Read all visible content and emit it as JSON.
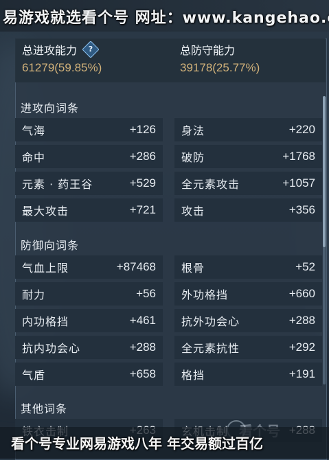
{
  "watermark_top": "易游戏就选看个号  网址：www.kangehao.c",
  "watermark_bottom": "看个号专业网易游戏八年  年交易额过百亿",
  "logo_text": "看个号",
  "summary": {
    "attack_label": "总进攻能力",
    "attack_value": "61279(59.85%)",
    "defense_label": "总防守能力",
    "defense_value": "39178(25.77%)",
    "info_icon_glyph": "?"
  },
  "sections": {
    "attack": {
      "title": "进攻向词条",
      "items": [
        {
          "name": "气海",
          "value": "+126"
        },
        {
          "name": "身法",
          "value": "+220"
        },
        {
          "name": "命中",
          "value": "+286"
        },
        {
          "name": "破防",
          "value": "+1768"
        },
        {
          "name": "元素 · 药王谷",
          "value": "+529"
        },
        {
          "name": "全元素攻击",
          "value": "+1057"
        },
        {
          "name": "最大攻击",
          "value": "+721"
        },
        {
          "name": "攻击",
          "value": "+356"
        }
      ]
    },
    "defense": {
      "title": "防御向词条",
      "items": [
        {
          "name": "气血上限",
          "value": "+87468"
        },
        {
          "name": "根骨",
          "value": "+52"
        },
        {
          "name": "耐力",
          "value": "+56"
        },
        {
          "name": "外功格挡",
          "value": "+660"
        },
        {
          "name": "内功格挡",
          "value": "+461"
        },
        {
          "name": "抗外功会心",
          "value": "+288"
        },
        {
          "name": "抗内功会心",
          "value": "+288"
        },
        {
          "name": "全元素抗性",
          "value": "+292"
        },
        {
          "name": "气盾",
          "value": "+658"
        },
        {
          "name": "格挡",
          "value": "+191"
        }
      ]
    },
    "other": {
      "title": "其他词条",
      "items": [
        {
          "name": "铁衣击制",
          "value": "+263"
        },
        {
          "name": "玄机击制",
          "value": "+288"
        }
      ]
    }
  },
  "colors": {
    "value_gold": "#d2b27a",
    "cell_bg": "#23303d",
    "panel_bg": "#2c3a48"
  }
}
